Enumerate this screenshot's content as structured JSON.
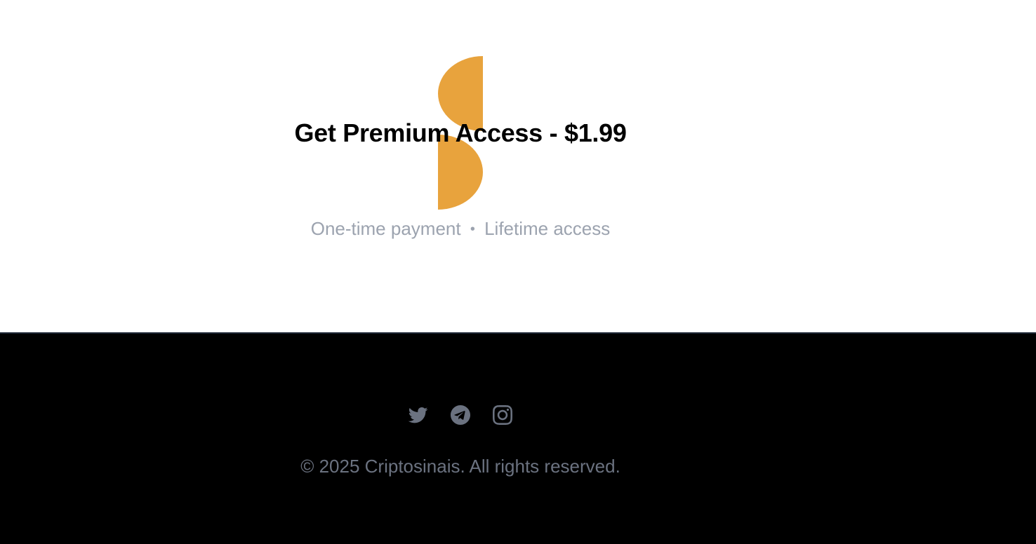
{
  "cta": {
    "title": "Get Premium Access - $1.99",
    "subtitle_part1": "One-time payment",
    "separator": "•",
    "subtitle_part2": "Lifetime access",
    "logo_color": "#e8a33d"
  },
  "footer": {
    "social": [
      {
        "name": "twitter",
        "icon": "twitter-icon"
      },
      {
        "name": "telegram",
        "icon": "telegram-icon"
      },
      {
        "name": "instagram",
        "icon": "instagram-icon"
      }
    ],
    "copyright": "© 2025 Criptosinais. All rights reserved.",
    "icon_color": "#6b7280",
    "background": "#000000"
  }
}
